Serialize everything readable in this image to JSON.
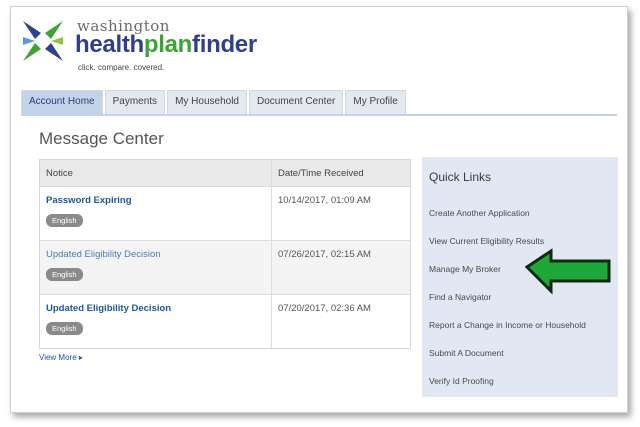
{
  "header": {
    "brand_top": "washington",
    "brand_main_a": "health",
    "brand_main_b": "plan",
    "brand_main_c": "finder",
    "tagline": "click. compare. covered."
  },
  "tabs": [
    {
      "label": "Account Home",
      "active": true
    },
    {
      "label": "Payments"
    },
    {
      "label": "My Household"
    },
    {
      "label": "Document Center"
    },
    {
      "label": "My Profile"
    }
  ],
  "page_title": "Message Center",
  "table": {
    "columns": [
      "Notice",
      "Date/Time Received"
    ],
    "rows": [
      {
        "notice": "Password Expiring",
        "badge": "English",
        "date": "10/14/2017, 01:09 AM"
      },
      {
        "notice": "Updated Eligibility Decision",
        "badge": "English",
        "date": "07/26/2017, 02:15 AM"
      },
      {
        "notice": "Updated Eligibility Decision",
        "badge": "English",
        "date": "07/20/2017, 02:36 AM"
      }
    ]
  },
  "view_more": "View More ▸",
  "quick_links": {
    "title": "Quick Links",
    "items": [
      "Create Another Application",
      "View Current Eligibility Results",
      "Manage My Broker",
      "Find a Navigator",
      "Report a Change in Income or Household",
      "Submit A Document",
      "Verify Id Proofing"
    ]
  },
  "colors": {
    "brand_blue": "#2f3f8f",
    "brand_green": "#3ea535",
    "arrow_green": "#1fa83a",
    "tab_active": "#c3d4ea",
    "quick_links_bg": "#e1e8f3"
  },
  "icons": {
    "logo": "logo-mark-icon",
    "annotation": "green-arrow-icon"
  }
}
